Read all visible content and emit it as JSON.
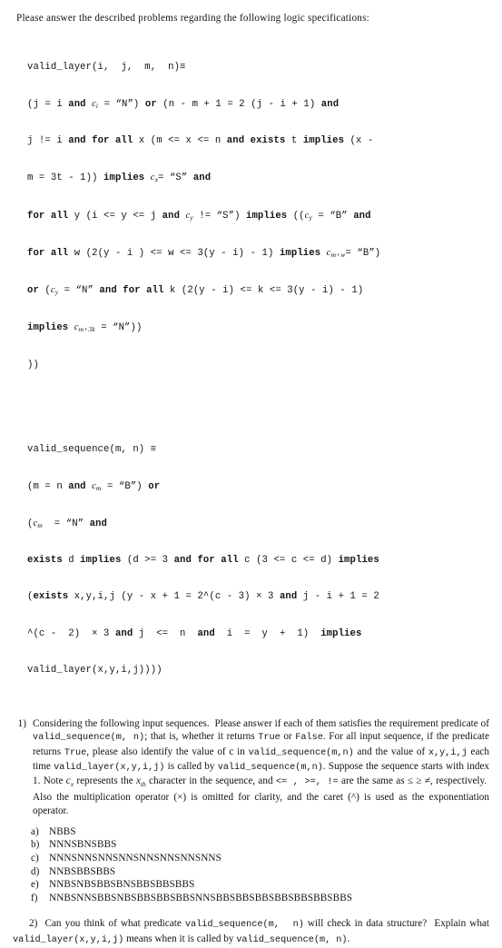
{
  "document": {
    "intro": "Please answer the described problems regarding the following logic specifications:",
    "spec_valid_layer": {
      "name": "valid_layer",
      "lines": [
        "valid_layer(i,  j,  m,  n)≡",
        "(j = i and c_i = “N”) or (n - m + 1 = 2 (j - i + 1) and",
        "j != i and for all x (m <= x <= n and exists t implies (x -",
        "m = 3t - 1)) implies c_x= “S” and",
        "for all y (i <= y <= j and c_y != “S”) implies ((c_y = “B” and",
        "for all w (2(y - i ) <= w <= 3(y - i) - 1) implies c_m+w= “B”)",
        "or (c_y = “N” and for all k (2(y - i) <= k <= 3(y - i) - 1)",
        "implies c_m+3k = “N”))",
        "))"
      ]
    },
    "spec_valid_sequence": {
      "name": "valid_sequence",
      "lines": [
        "valid_sequence(m, n) ≡",
        "(m = n and c_m = “B”) or",
        "(c_m  = “N” and",
        "exists d implies (d >= 3 and for all c (3 <= c <= d) implies",
        "(exists x,y,i,j (y - x + 1 = 2^(c - 3) × 3 and j - i + 1 = 2",
        "^(c - 2)  × 3 and j <= n and i = y + 1) implies",
        "valid_layer(x,y,i,j))))"
      ]
    },
    "question1": {
      "number": "1)",
      "text_parts": [
        "Considering the following input sequences.  Please answer if each of them satisfies the requirement predicate of ",
        "valid_sequence(m, n)",
        "; that is, whether it returns ",
        "True",
        " or ",
        "False",
        ". For all input sequence, if the predicate returns ",
        "True",
        ", please also identify the value of c in ",
        "valid_sequence(m,n)",
        " and the value of ",
        "x,y,i,j",
        " each time ",
        "valid_layer(x,y,i,j)",
        " is called by ",
        "valid_sequence(m,n)",
        ". Suppose the sequence starts with index 1. Note ",
        "c_x",
        " represents the ",
        "x_th",
        " character in the sequence, and ",
        "<= , >=, !=",
        " are the same as ≤ ≥ ≠, respectively.  Also the multiplication operator (×) is omitted for clarity, and the caret (^) is used as the exponentiation operator."
      ],
      "options": [
        {
          "label": "a)",
          "value": "NBBS"
        },
        {
          "label": "b)",
          "value": "NNNSBNSBBS"
        },
        {
          "label": "c)",
          "value": "NNNSNNSNNSNNSNNSNNSNNSNNS"
        },
        {
          "label": "d)",
          "value": "NNBSBBSBBS"
        },
        {
          "label": "e)",
          "value": "NNBSNBSBBSBNSBBSBBSBBS"
        },
        {
          "label": "f)",
          "value": "NNBSNNSBBSNBSBBSBBSBBSNNSBBSBBSBBSBBSBBSBBSBBS"
        }
      ]
    },
    "question2": {
      "number": "2)",
      "text_parts": [
        "Can you think of what predicate ",
        "valid_sequence(m,  n)",
        " will check in data structure?  Explain what ",
        "valid_layer(x,y,i,j)",
        " means when it is called by ",
        "valid_sequence(m, n)",
        "."
      ]
    }
  }
}
